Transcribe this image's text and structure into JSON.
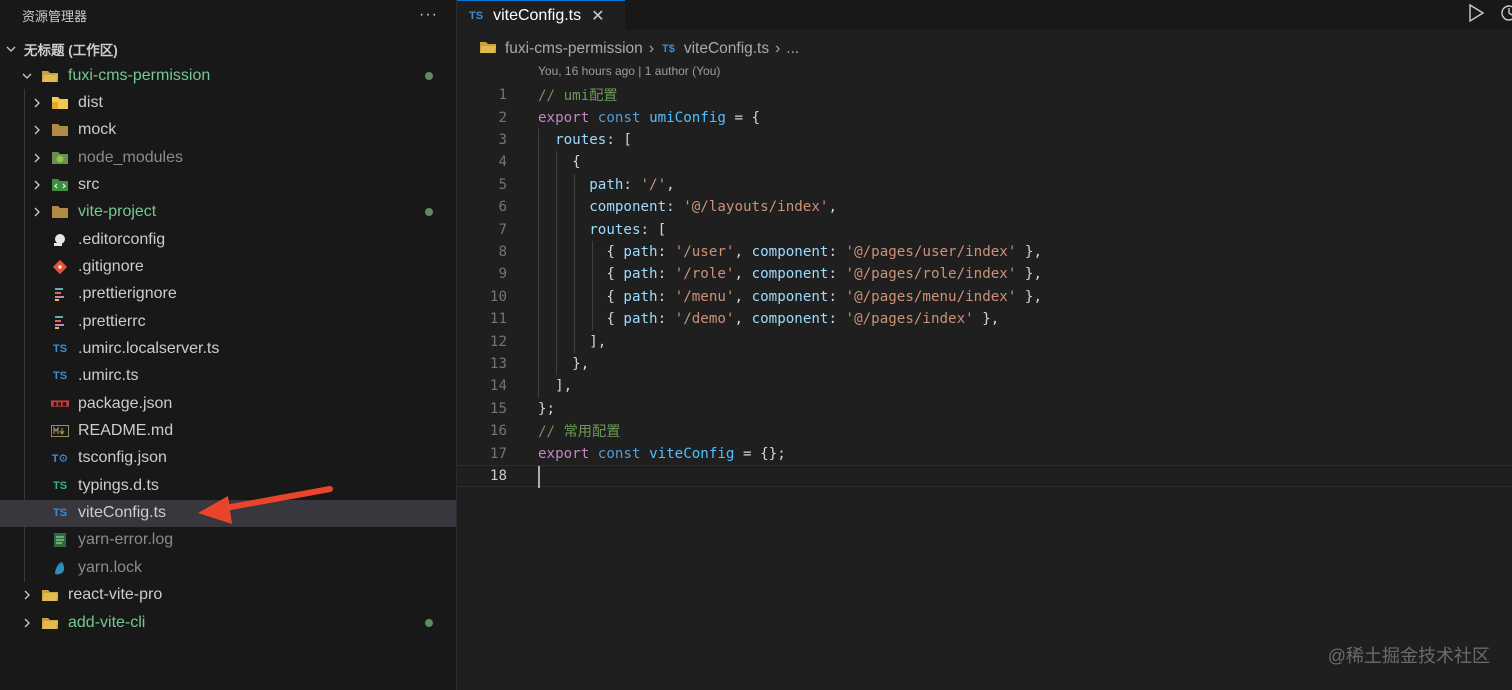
{
  "sidebar": {
    "title": "资源管理器",
    "more": "···",
    "workspace": "无标题 (工作区)",
    "items": [
      {
        "label": "fuxi-cms-permission",
        "icon": "folder-open-icon",
        "color": "green"
      },
      {
        "label": "dist",
        "icon": "folder-dist-icon",
        "color": "white"
      },
      {
        "label": "mock",
        "icon": "folder-icon",
        "color": "white"
      },
      {
        "label": "node_modules",
        "icon": "folder-node-icon",
        "color": "gray"
      },
      {
        "label": "src",
        "icon": "folder-src-icon",
        "color": "white"
      },
      {
        "label": "vite-project",
        "icon": "folder-icon",
        "color": "green"
      },
      {
        "label": ".editorconfig",
        "icon": "editorconfig-icon",
        "color": "white"
      },
      {
        "label": ".gitignore",
        "icon": "git-icon",
        "color": "white"
      },
      {
        "label": ".prettierignore",
        "icon": "prettier-icon",
        "color": "white"
      },
      {
        "label": ".prettierrc",
        "icon": "prettier-icon",
        "color": "white"
      },
      {
        "label": ".umirc.localserver.ts",
        "icon": "typescript-icon",
        "color": "white"
      },
      {
        "label": ".umirc.ts",
        "icon": "typescript-icon",
        "color": "white"
      },
      {
        "label": "package.json",
        "icon": "npm-icon",
        "color": "white"
      },
      {
        "label": "README.md",
        "icon": "markdown-icon",
        "color": "white"
      },
      {
        "label": "tsconfig.json",
        "icon": "tsconfig-icon",
        "color": "white"
      },
      {
        "label": "typings.d.ts",
        "icon": "typescript-def-icon",
        "color": "white"
      },
      {
        "label": "viteConfig.ts",
        "icon": "typescript-icon",
        "color": "white"
      },
      {
        "label": "yarn-error.log",
        "icon": "log-icon",
        "color": "gray"
      },
      {
        "label": "yarn.lock",
        "icon": "yarn-icon",
        "color": "gray"
      },
      {
        "label": "react-vite-pro",
        "icon": "folder-closed-icon",
        "color": "white"
      },
      {
        "label": "add-vite-cli",
        "icon": "folder-closed-icon",
        "color": "green"
      }
    ]
  },
  "tab": {
    "badge": "TS",
    "title": "viteConfig.ts",
    "close": "✕"
  },
  "breadcrumb": {
    "folder": "fuxi-cms-permission",
    "badge": "T$",
    "file": "viteConfig.ts",
    "more": "..."
  },
  "blame": "You, 16 hours ago | 1 author (You)",
  "code": {
    "lines": [
      {
        "n": "1",
        "html": [
          [
            "tk-comment",
            "// umi配置"
          ]
        ]
      },
      {
        "n": "2",
        "html": [
          [
            "tk-keyword",
            "export"
          ],
          [
            "tk-punct",
            " "
          ],
          [
            "tk-storage",
            "const"
          ],
          [
            "tk-punct",
            " "
          ],
          [
            "tk-const",
            "umiConfig"
          ],
          [
            "tk-punct",
            " = {"
          ]
        ]
      },
      {
        "n": "3",
        "html": [
          [
            "tk-punct",
            "  "
          ],
          [
            "tk-var",
            "routes"
          ],
          [
            "tk-punct",
            ": ["
          ]
        ]
      },
      {
        "n": "4",
        "html": [
          [
            "tk-punct",
            "    {"
          ]
        ]
      },
      {
        "n": "5",
        "html": [
          [
            "tk-punct",
            "      "
          ],
          [
            "tk-var",
            "path"
          ],
          [
            "tk-punct",
            ": "
          ],
          [
            "tk-string",
            "'/'"
          ],
          [
            "tk-punct",
            ","
          ]
        ]
      },
      {
        "n": "6",
        "html": [
          [
            "tk-punct",
            "      "
          ],
          [
            "tk-var",
            "component"
          ],
          [
            "tk-punct",
            ": "
          ],
          [
            "tk-string",
            "'@/layouts/index'"
          ],
          [
            "tk-punct",
            ","
          ]
        ]
      },
      {
        "n": "7",
        "html": [
          [
            "tk-punct",
            "      "
          ],
          [
            "tk-var",
            "routes"
          ],
          [
            "tk-punct",
            ": ["
          ]
        ]
      },
      {
        "n": "8",
        "html": [
          [
            "tk-punct",
            "        { "
          ],
          [
            "tk-var",
            "path"
          ],
          [
            "tk-punct",
            ": "
          ],
          [
            "tk-string",
            "'/user'"
          ],
          [
            "tk-punct",
            ", "
          ],
          [
            "tk-var",
            "component"
          ],
          [
            "tk-punct",
            ": "
          ],
          [
            "tk-string",
            "'@/pages/user/index'"
          ],
          [
            "tk-punct",
            " },"
          ]
        ]
      },
      {
        "n": "9",
        "html": [
          [
            "tk-punct",
            "        { "
          ],
          [
            "tk-var",
            "path"
          ],
          [
            "tk-punct",
            ": "
          ],
          [
            "tk-string",
            "'/role'"
          ],
          [
            "tk-punct",
            ", "
          ],
          [
            "tk-var",
            "component"
          ],
          [
            "tk-punct",
            ": "
          ],
          [
            "tk-string",
            "'@/pages/role/index'"
          ],
          [
            "tk-punct",
            " },"
          ]
        ]
      },
      {
        "n": "10",
        "html": [
          [
            "tk-punct",
            "        { "
          ],
          [
            "tk-var",
            "path"
          ],
          [
            "tk-punct",
            ": "
          ],
          [
            "tk-string",
            "'/menu'"
          ],
          [
            "tk-punct",
            ", "
          ],
          [
            "tk-var",
            "component"
          ],
          [
            "tk-punct",
            ": "
          ],
          [
            "tk-string",
            "'@/pages/menu/index'"
          ],
          [
            "tk-punct",
            " },"
          ]
        ]
      },
      {
        "n": "11",
        "html": [
          [
            "tk-punct",
            "        { "
          ],
          [
            "tk-var",
            "path"
          ],
          [
            "tk-punct",
            ": "
          ],
          [
            "tk-string",
            "'/demo'"
          ],
          [
            "tk-punct",
            ", "
          ],
          [
            "tk-var",
            "component"
          ],
          [
            "tk-punct",
            ": "
          ],
          [
            "tk-string",
            "'@/pages/index'"
          ],
          [
            "tk-punct",
            " },"
          ]
        ]
      },
      {
        "n": "12",
        "html": [
          [
            "tk-punct",
            "      ],"
          ]
        ]
      },
      {
        "n": "13",
        "html": [
          [
            "tk-punct",
            "    },"
          ]
        ]
      },
      {
        "n": "14",
        "html": [
          [
            "tk-punct",
            "  ],"
          ]
        ]
      },
      {
        "n": "15",
        "html": [
          [
            "tk-punct",
            "};"
          ]
        ]
      },
      {
        "n": "16",
        "html": [
          [
            "tk-comment",
            "// 常用配置"
          ]
        ]
      },
      {
        "n": "17",
        "html": [
          [
            "tk-keyword",
            "export"
          ],
          [
            "tk-punct",
            " "
          ],
          [
            "tk-storage",
            "const"
          ],
          [
            "tk-punct",
            " "
          ],
          [
            "tk-const",
            "viteConfig"
          ],
          [
            "tk-punct",
            " = {};"
          ]
        ]
      },
      {
        "n": "18",
        "html": []
      }
    ]
  },
  "watermark": "@稀土掘金技术社区",
  "colors": {
    "accent": "#0078d4",
    "green_git": "#73c991",
    "ts_blue": "#3b8ed8",
    "arrow": "#e8452c"
  }
}
